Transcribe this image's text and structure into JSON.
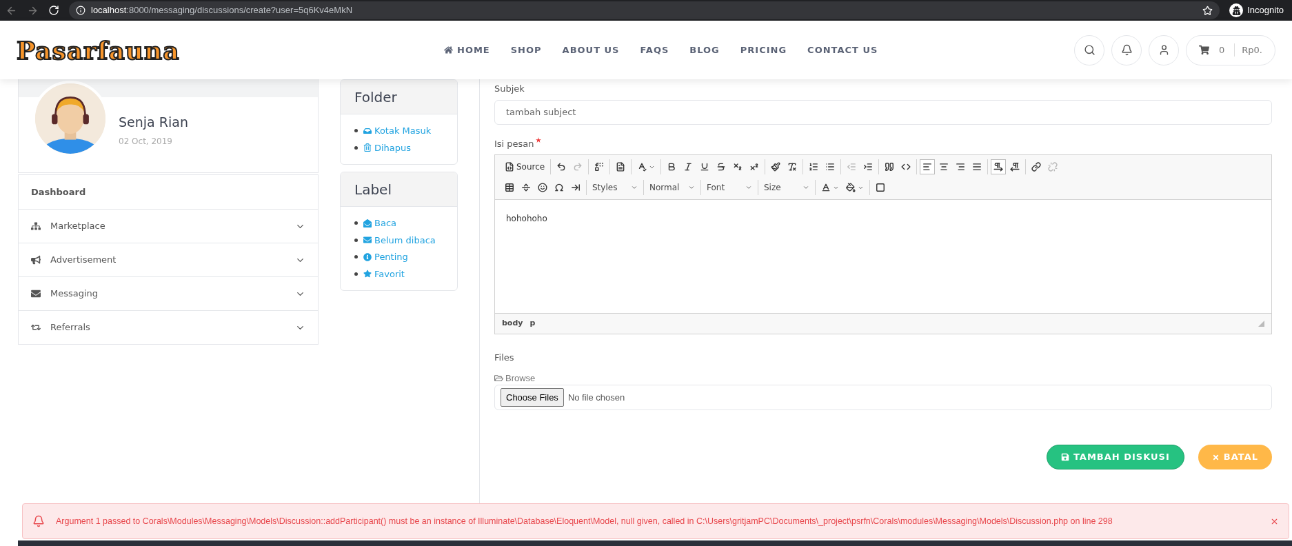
{
  "browser": {
    "url": "**localhost**:8000/messaging/discussions/create?user=5q6Kv4eMkN",
    "profile": "Incognito"
  },
  "header": {
    "logo": "Pasarfauna",
    "nav": [
      {
        "label": "HOME",
        "kind": "home"
      },
      {
        "label": "SHOP",
        "kind": "plain"
      },
      {
        "label": "ABOUT US",
        "kind": "plain"
      },
      {
        "label": "FAQS",
        "kind": "plain"
      },
      {
        "label": "BLOG",
        "kind": "plain"
      },
      {
        "label": "PRICING",
        "kind": "plain"
      },
      {
        "label": "CONTACT US",
        "kind": "plain"
      }
    ],
    "cart": {
      "count": "0",
      "total": "Rp0."
    }
  },
  "profile": {
    "name": "Senja Rian",
    "date": "02 Oct, 2019"
  },
  "sidebar": {
    "items": [
      {
        "label": "Dashboard",
        "expandable": false
      },
      {
        "label": "Marketplace",
        "expandable": true
      },
      {
        "label": "Advertisement",
        "expandable": true
      },
      {
        "label": "Messaging",
        "expandable": true
      },
      {
        "label": "Referrals",
        "expandable": true
      }
    ]
  },
  "folder": {
    "title": "Folder",
    "items": [
      "Kotak Masuk",
      "Dihapus"
    ]
  },
  "labels": {
    "title": "Label",
    "items": [
      "Baca",
      "Belum dibaca",
      "Penting",
      "Favorit"
    ]
  },
  "form": {
    "subject": {
      "label": "Subjek",
      "placeholder": "tambah subject"
    },
    "message": {
      "label": "Isi pesan",
      "required": true,
      "content": "hohohoho",
      "path": [
        "body",
        "p"
      ],
      "toolbar": [
        [
          [
            {
              "kind": "button",
              "label": "Source",
              "on": false,
              "disabled": false
            }
          ],
          [
            {
              "kind": "button",
              "on": false,
              "disabled": false
            },
            {
              "kind": "button",
              "on": false,
              "disabled": true
            }
          ],
          [
            {
              "kind": "button",
              "on": false,
              "disabled": false
            }
          ],
          [
            {
              "kind": "button",
              "on": false,
              "disabled": false
            }
          ],
          [
            {
              "kind": "menu",
              "on": false,
              "disabled": false
            }
          ],
          [
            {
              "kind": "button",
              "on": false,
              "disabled": false
            },
            {
              "kind": "button",
              "on": false,
              "disabled": false
            },
            {
              "kind": "button",
              "on": false,
              "disabled": false
            },
            {
              "kind": "button",
              "on": false,
              "disabled": false
            },
            {
              "kind": "button",
              "on": false,
              "disabled": false
            },
            {
              "kind": "button",
              "on": false,
              "disabled": false
            }
          ],
          [
            {
              "kind": "button",
              "on": false,
              "disabled": false
            },
            {
              "kind": "button",
              "on": false,
              "disabled": false
            }
          ],
          [
            {
              "kind": "button",
              "on": false,
              "disabled": false
            },
            {
              "kind": "button",
              "on": false,
              "disabled": false
            }
          ],
          [
            {
              "kind": "button",
              "on": false,
              "disabled": true
            },
            {
              "kind": "button",
              "on": false,
              "disabled": false
            }
          ],
          [
            {
              "kind": "button",
              "on": false,
              "disabled": false
            },
            {
              "kind": "button",
              "on": false,
              "disabled": false
            }
          ],
          [
            {
              "kind": "button",
              "on": true,
              "disabled": false
            },
            {
              "kind": "button",
              "on": false,
              "disabled": false
            },
            {
              "kind": "button",
              "on": false,
              "disabled": false
            },
            {
              "kind": "button",
              "on": false,
              "disabled": false
            }
          ],
          [
            {
              "kind": "button",
              "on": true,
              "disabled": false
            },
            {
              "kind": "button",
              "on": false,
              "disabled": false
            }
          ],
          [
            {
              "kind": "button",
              "on": false,
              "disabled": false
            },
            {
              "kind": "button",
              "on": false,
              "disabled": true
            }
          ]
        ],
        [
          [
            {
              "kind": "button",
              "on": false,
              "disabled": false
            },
            {
              "kind": "button",
              "on": false,
              "disabled": false
            },
            {
              "kind": "button",
              "on": false,
              "disabled": false
            },
            {
              "kind": "button",
              "on": false,
              "disabled": false
            },
            {
              "kind": "button",
              "on": false,
              "disabled": false
            }
          ],
          [
            {
              "kind": "combo",
              "label": "Styles"
            }
          ],
          [
            {
              "kind": "combo",
              "label": "Normal"
            }
          ],
          [
            {
              "kind": "combo",
              "label": "Font"
            }
          ],
          [
            {
              "kind": "combo",
              "label": "Size"
            }
          ],
          [
            {
              "kind": "menu",
              "on": false,
              "disabled": false
            },
            {
              "kind": "menu",
              "on": false,
              "disabled": false
            }
          ],
          [
            {
              "kind": "button",
              "on": false,
              "disabled": false
            }
          ]
        ]
      ]
    },
    "files": {
      "label": "Files",
      "browse": "Browse",
      "button": "Choose Files",
      "status": "No file chosen"
    },
    "actions": [
      {
        "label": "TAMBAH DISKUSI",
        "kind": "primary"
      },
      {
        "label": "BATAL",
        "kind": "cancel"
      }
    ]
  },
  "alert": {
    "message": "Argument 1 passed to Corals\\Modules\\Messaging\\Models\\Discussion::addParticipant() must be an instance of Illuminate\\Database\\Eloquent\\Model, null given, called in C:\\Users\\gritjamPC\\Documents\\_project\\psrfn\\Corals\\modules\\Messaging\\Models\\Discussion.php on line 298"
  }
}
